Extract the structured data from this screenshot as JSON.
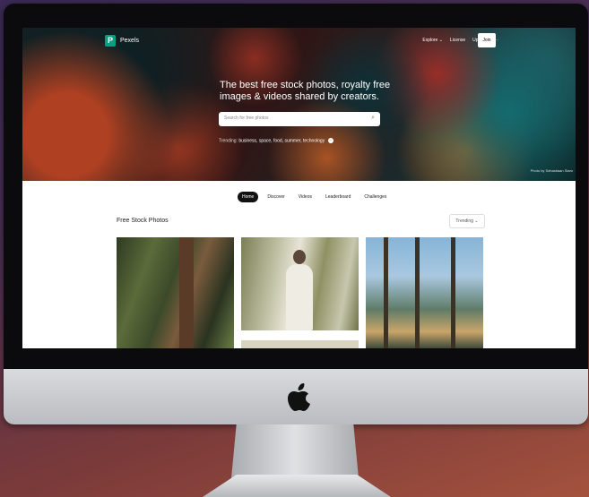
{
  "site": {
    "brand": "Pexels",
    "nav": [
      "Explore ⌄",
      "License",
      "Upload",
      "···"
    ],
    "join_label": "Join"
  },
  "hero": {
    "headline": "The best free stock photos, royalty free images & videos shared by creators.",
    "search_placeholder": "Search for free photos",
    "trending_label": "Trending:",
    "trending_terms": "business, space, food, summer, technology",
    "more_label": "···",
    "credit": "Photo by Sebastiaan Stam"
  },
  "tabs": [
    "Home",
    "Discover",
    "Videos",
    "Leaderboard",
    "Challenges"
  ],
  "content": {
    "section_title": "Free Stock Photos",
    "sort_label": "Trending ⌄"
  },
  "colors": {
    "brand_green": "#05a081",
    "active_tab": "#111111"
  }
}
